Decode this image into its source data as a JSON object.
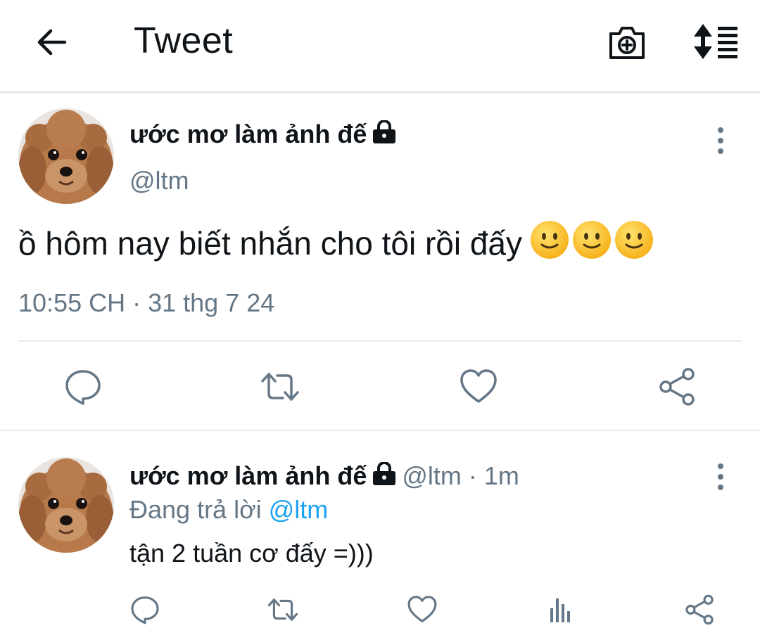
{
  "header": {
    "title": "Tweet",
    "back_icon": "back-arrow-icon",
    "camera_icon": "camera-add-icon",
    "sort_icon": "sort-icon"
  },
  "main_tweet": {
    "author_name": "ước mơ làm ảnh đế",
    "handle": "@ltm",
    "text": "ồ hôm nay biết nhắn cho tôi rồi đấy",
    "emojis": [
      "🙂",
      "🙂",
      "🙂"
    ],
    "meta": "10:55 CH · 31 thg 7 24",
    "actions": [
      "reply-icon",
      "retweet-icon",
      "like-icon",
      "share-icon"
    ]
  },
  "reply_tweet": {
    "author_name": "ước mơ làm ảnh đế",
    "handle_time": "@ltm · 1m",
    "replying_label": "Đang trả lời",
    "replying_mention": "@ltm",
    "text": "tận 2 tuần cơ đấy =)))",
    "actions": [
      "reply-icon",
      "retweet-icon",
      "like-icon",
      "stats-icon",
      "share-icon"
    ]
  },
  "colors": {
    "text": "#0f1419",
    "secondary": "#657786",
    "accent": "#1da1f2",
    "divider": "#e6ecf0"
  }
}
